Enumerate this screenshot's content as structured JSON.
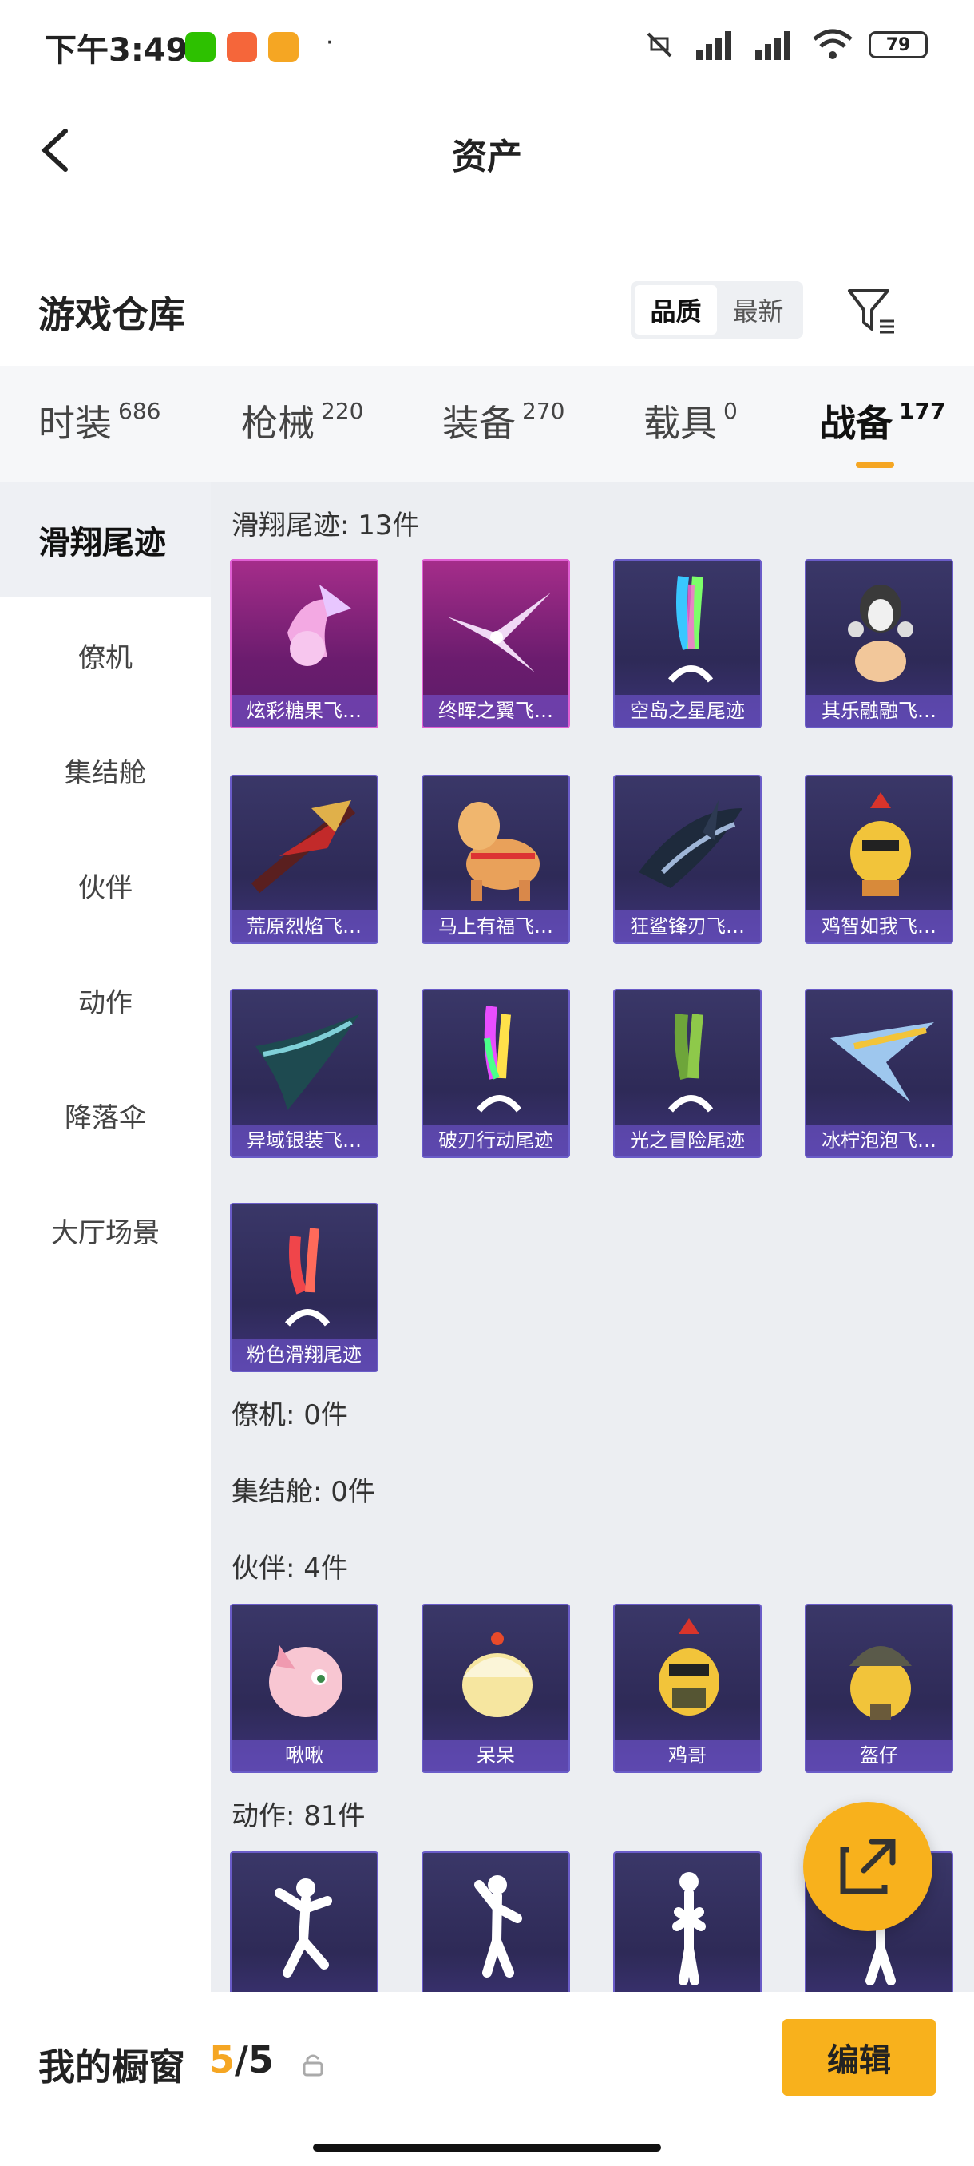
{
  "status": {
    "time": "下午3:49",
    "battery": "79",
    "dot": "·"
  },
  "nav": {
    "title": "资产"
  },
  "warehouse": {
    "title": "游戏仓库",
    "sort_quality": "品质",
    "sort_latest": "最新"
  },
  "tabs": [
    {
      "label": "时装",
      "count": "686"
    },
    {
      "label": "枪械",
      "count": "220"
    },
    {
      "label": "装备",
      "count": "270"
    },
    {
      "label": "载具",
      "count": "0"
    },
    {
      "label": "战备",
      "count": "177"
    }
  ],
  "sidebar": [
    "滑翔尾迹",
    "僚机",
    "集结舱",
    "伙伴",
    "动作",
    "降落伞",
    "大厅场景"
  ],
  "sections": {
    "glide": "滑翔尾迹: 13件",
    "wingman": "僚机: 0件",
    "pod": "集结舱: 0件",
    "partner": "伙伴: 4件",
    "action": "动作: 81件"
  },
  "glide_items": [
    "炫彩糖果飞…",
    "终晖之翼飞…",
    "空岛之星尾迹",
    "其乐融融飞…",
    "荒原烈焰飞…",
    "马上有福飞…",
    "狂鲨锋刃飞…",
    "鸡智如我飞…",
    "异域银装飞…",
    "破刃行动尾迹",
    "光之冒险尾迹",
    "冰柠泡泡飞…",
    "粉色滑翔尾迹"
  ],
  "partner_items": [
    "啾啾",
    "呆呆",
    "鸡哥",
    "盔仔"
  ],
  "bottom": {
    "label": "我的橱窗",
    "count_current": "5",
    "count_total": "/5",
    "edit": "编辑"
  },
  "colors": {
    "accent": "#f8b11c",
    "card_purple": "#3a3768",
    "card_pink": "#a52d8a"
  }
}
